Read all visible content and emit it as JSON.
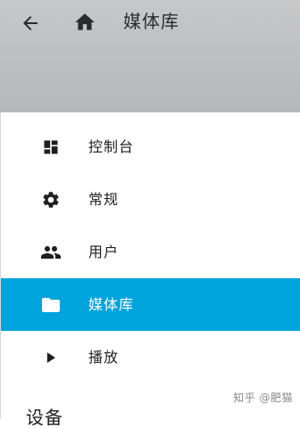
{
  "header": {
    "back_icon": "arrow-back-icon",
    "home_icon": "home-icon",
    "title": "媒体库"
  },
  "drawer": {
    "items": [
      {
        "label": "控制台",
        "icon": "dashboard-icon",
        "active": false
      },
      {
        "label": "常规",
        "icon": "settings-gear-icon",
        "active": false
      },
      {
        "label": "用户",
        "icon": "people-icon",
        "active": false
      },
      {
        "label": "媒体库",
        "icon": "folder-icon",
        "active": true
      },
      {
        "label": "播放",
        "icon": "play-icon",
        "active": false
      }
    ],
    "section_title": "设备"
  },
  "watermark": "知乎 @肥猫",
  "colors": {
    "header_bg": "#bcbfc2",
    "active_bg": "#00a4dc",
    "icon_dark": "#1f1f1f",
    "active_text": "#ffffff"
  }
}
